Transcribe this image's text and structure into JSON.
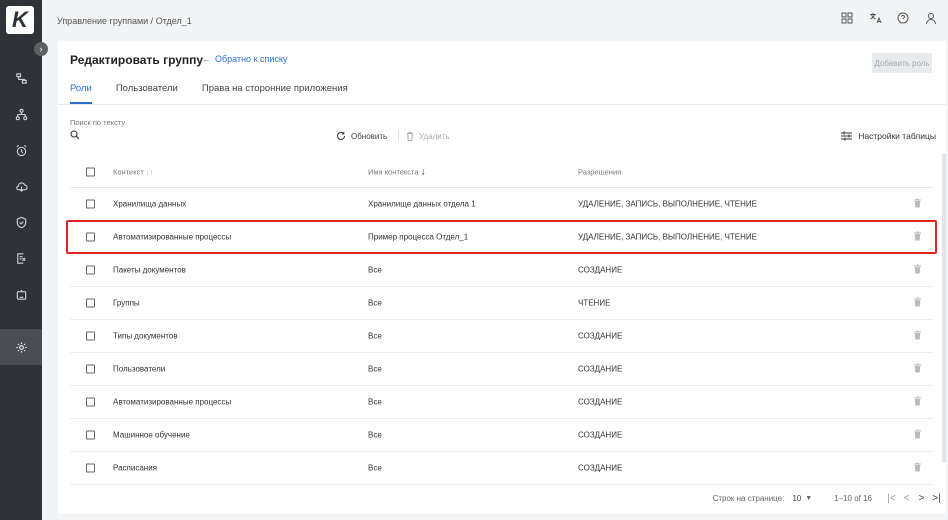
{
  "app": {
    "logo_letter": "K"
  },
  "breadcrumb": "Управление группами / Отдел_1",
  "header": {
    "title": "Редактировать группу",
    "back_link": "Обратно к списку",
    "add_role_button": "Добавить роль"
  },
  "tabs": [
    {
      "label": "Роли",
      "active": true
    },
    {
      "label": "Пользователи",
      "active": false
    },
    {
      "label": "Права на сторонние приложения",
      "active": false
    }
  ],
  "toolbar": {
    "search_label": "Поиск по тексту",
    "search_value": "",
    "refresh": "Обновить",
    "delete": "Удалить",
    "table_settings": "Настройки таблицы"
  },
  "table": {
    "columns": [
      "Контекст",
      "Имя контекста",
      "Разрешения"
    ],
    "rows": [
      {
        "context": "Хранилища данных",
        "name": "Хранилище данных отдела 1",
        "permissions": "УДАЛЕНИЕ, ЗАПИСЬ, ВЫПОЛНЕНИЕ, ЧТЕНИЕ"
      },
      {
        "context": "Автоматизированные процессы",
        "name": "Пример процесса Отдел_1",
        "permissions": "УДАЛЕНИЕ, ЗАПИСЬ, ВЫПОЛНЕНИЕ, ЧТЕНИЕ"
      },
      {
        "context": "Пакеты документов",
        "name": "Все",
        "permissions": "СОЗДАНИЕ"
      },
      {
        "context": "Группы",
        "name": "Все",
        "permissions": "ЧТЕНИЕ"
      },
      {
        "context": "Типы документов",
        "name": "Все",
        "permissions": "СОЗДАНИЕ"
      },
      {
        "context": "Пользователи",
        "name": "Все",
        "permissions": "СОЗДАНИЕ"
      },
      {
        "context": "Автоматизированные процессы",
        "name": "Все",
        "permissions": "СОЗДАНИЕ"
      },
      {
        "context": "Машинное обучение",
        "name": "Все",
        "permissions": "СОЗДАНИЕ"
      },
      {
        "context": "Расписания",
        "name": "Все",
        "permissions": "СОЗДАНИЕ"
      }
    ]
  },
  "pagination": {
    "rows_per_page_label": "Строк на странице:",
    "rows_per_page": "10",
    "range": "1–10 of 16"
  },
  "colors": {
    "accent": "#2b6fd8",
    "sidebar": "#2f3236",
    "highlight": "#e02424"
  }
}
